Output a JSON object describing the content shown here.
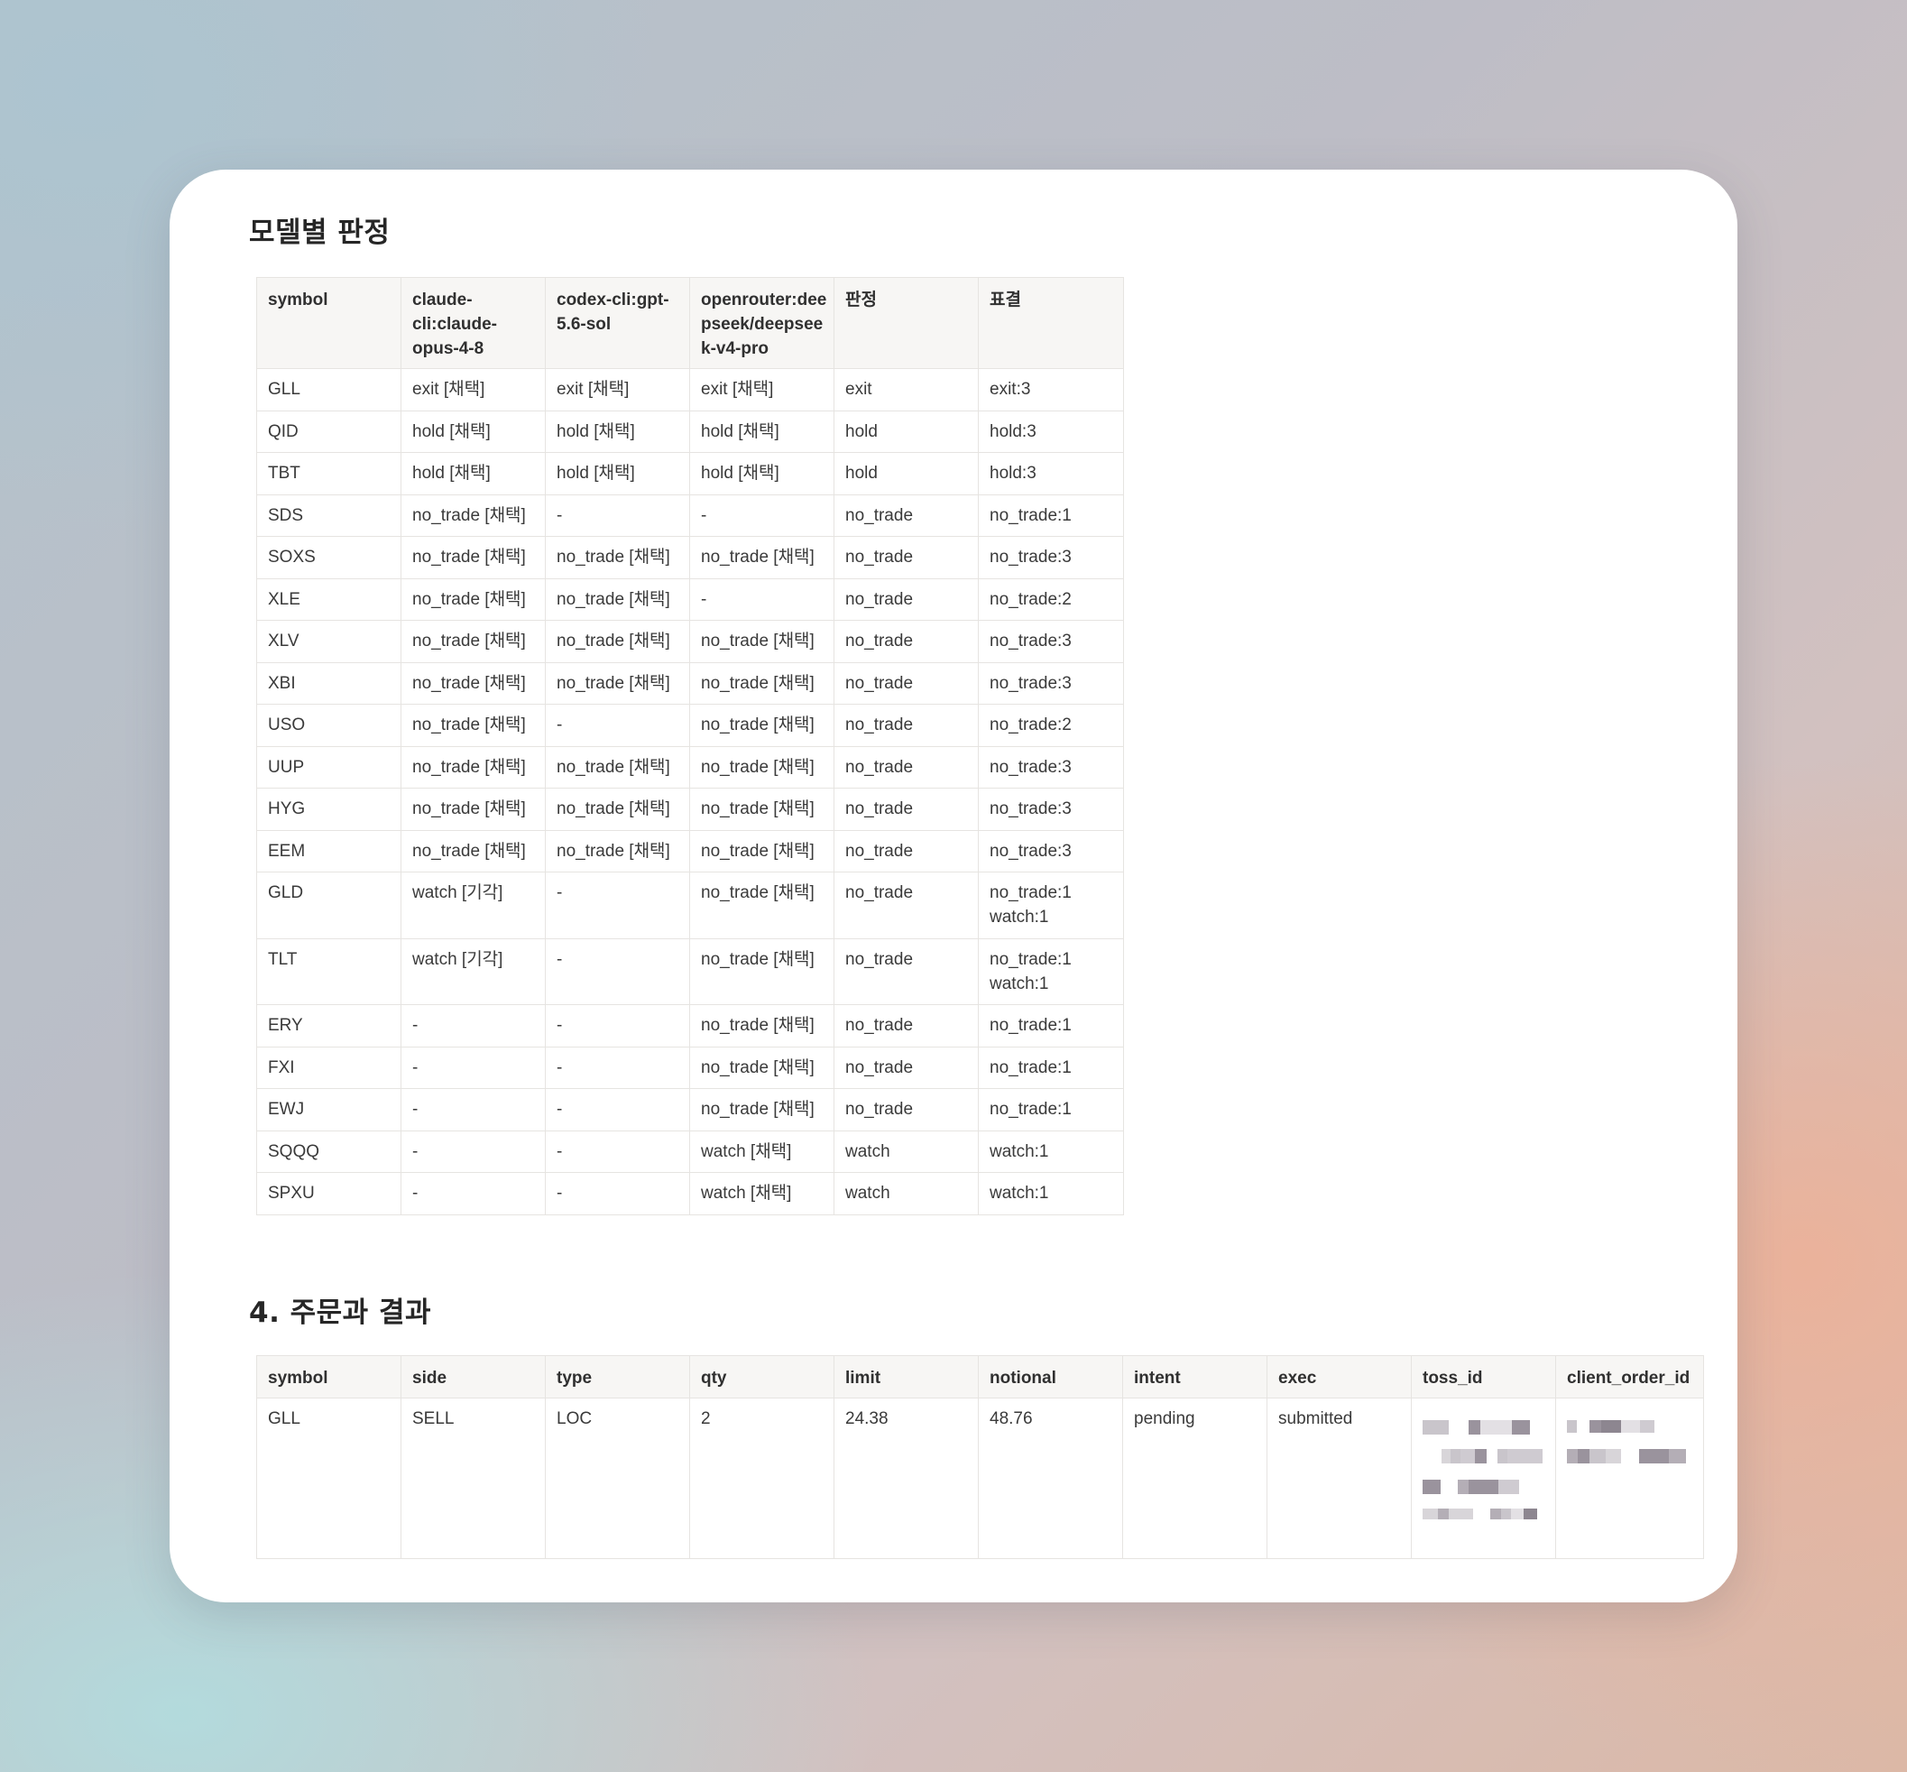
{
  "model_section": {
    "heading": "모델별 판정",
    "columns": [
      "symbol",
      "claude-cli:claude-opus-4-8",
      "codex-cli:gpt-5.6-sol",
      "openrouter:deepseek/deepseek-v4-pro",
      "판정",
      "표결"
    ],
    "header_lines": [
      [
        "symbol"
      ],
      [
        "claude-",
        "cli:claude-",
        "opus-4-8"
      ],
      [
        "codex-cli:gpt-",
        "5.6-sol"
      ],
      [
        "openrouter:dee",
        "pseek/deepsee",
        "k-v4-pro"
      ],
      [
        "판정"
      ],
      [
        "표결"
      ]
    ],
    "rows": [
      [
        "GLL",
        "exit [채택]",
        "exit [채택]",
        "exit [채택]",
        "exit",
        "exit:3"
      ],
      [
        "QID",
        "hold [채택]",
        "hold [채택]",
        "hold [채택]",
        "hold",
        "hold:3"
      ],
      [
        "TBT",
        "hold [채택]",
        "hold [채택]",
        "hold [채택]",
        "hold",
        "hold:3"
      ],
      [
        "SDS",
        "no_trade [채택]",
        "-",
        "-",
        "no_trade",
        "no_trade:1"
      ],
      [
        "SOXS",
        "no_trade [채택]",
        "no_trade [채택]",
        "no_trade [채택]",
        "no_trade",
        "no_trade:3"
      ],
      [
        "XLE",
        "no_trade [채택]",
        "no_trade [채택]",
        "-",
        "no_trade",
        "no_trade:2"
      ],
      [
        "XLV",
        "no_trade [채택]",
        "no_trade [채택]",
        "no_trade [채택]",
        "no_trade",
        "no_trade:3"
      ],
      [
        "XBI",
        "no_trade [채택]",
        "no_trade [채택]",
        "no_trade [채택]",
        "no_trade",
        "no_trade:3"
      ],
      [
        "USO",
        "no_trade [채택]",
        "-",
        "no_trade [채택]",
        "no_trade",
        "no_trade:2"
      ],
      [
        "UUP",
        "no_trade [채택]",
        "no_trade [채택]",
        "no_trade [채택]",
        "no_trade",
        "no_trade:3"
      ],
      [
        "HYG",
        "no_trade [채택]",
        "no_trade [채택]",
        "no_trade [채택]",
        "no_trade",
        "no_trade:3"
      ],
      [
        "EEM",
        "no_trade [채택]",
        "no_trade [채택]",
        "no_trade [채택]",
        "no_trade",
        "no_trade:3"
      ],
      [
        "GLD",
        "watch [기각]",
        "-",
        "no_trade [채택]",
        "no_trade",
        "no_trade:1 watch:1"
      ],
      [
        "TLT",
        "watch [기각]",
        "-",
        "no_trade [채택]",
        "no_trade",
        "no_trade:1 watch:1"
      ],
      [
        "ERY",
        "-",
        "-",
        "no_trade [채택]",
        "no_trade",
        "no_trade:1"
      ],
      [
        "FXI",
        "-",
        "-",
        "no_trade [채택]",
        "no_trade",
        "no_trade:1"
      ],
      [
        "EWJ",
        "-",
        "-",
        "no_trade [채택]",
        "no_trade",
        "no_trade:1"
      ],
      [
        "SQQQ",
        "-",
        "-",
        "watch [채택]",
        "watch",
        "watch:1"
      ],
      [
        "SPXU",
        "-",
        "-",
        "watch [채택]",
        "watch",
        "watch:1"
      ]
    ]
  },
  "orders_section": {
    "heading": "4. 주문과 결과",
    "columns": [
      "symbol",
      "side",
      "type",
      "qty",
      "limit",
      "notional",
      "intent",
      "exec",
      "toss_id",
      "client_order_id"
    ],
    "rows": [
      [
        "GLL",
        "SELL",
        "LOC",
        "2",
        "24.38",
        "48.76",
        "pending",
        "submitted",
        "",
        ""
      ]
    ]
  }
}
